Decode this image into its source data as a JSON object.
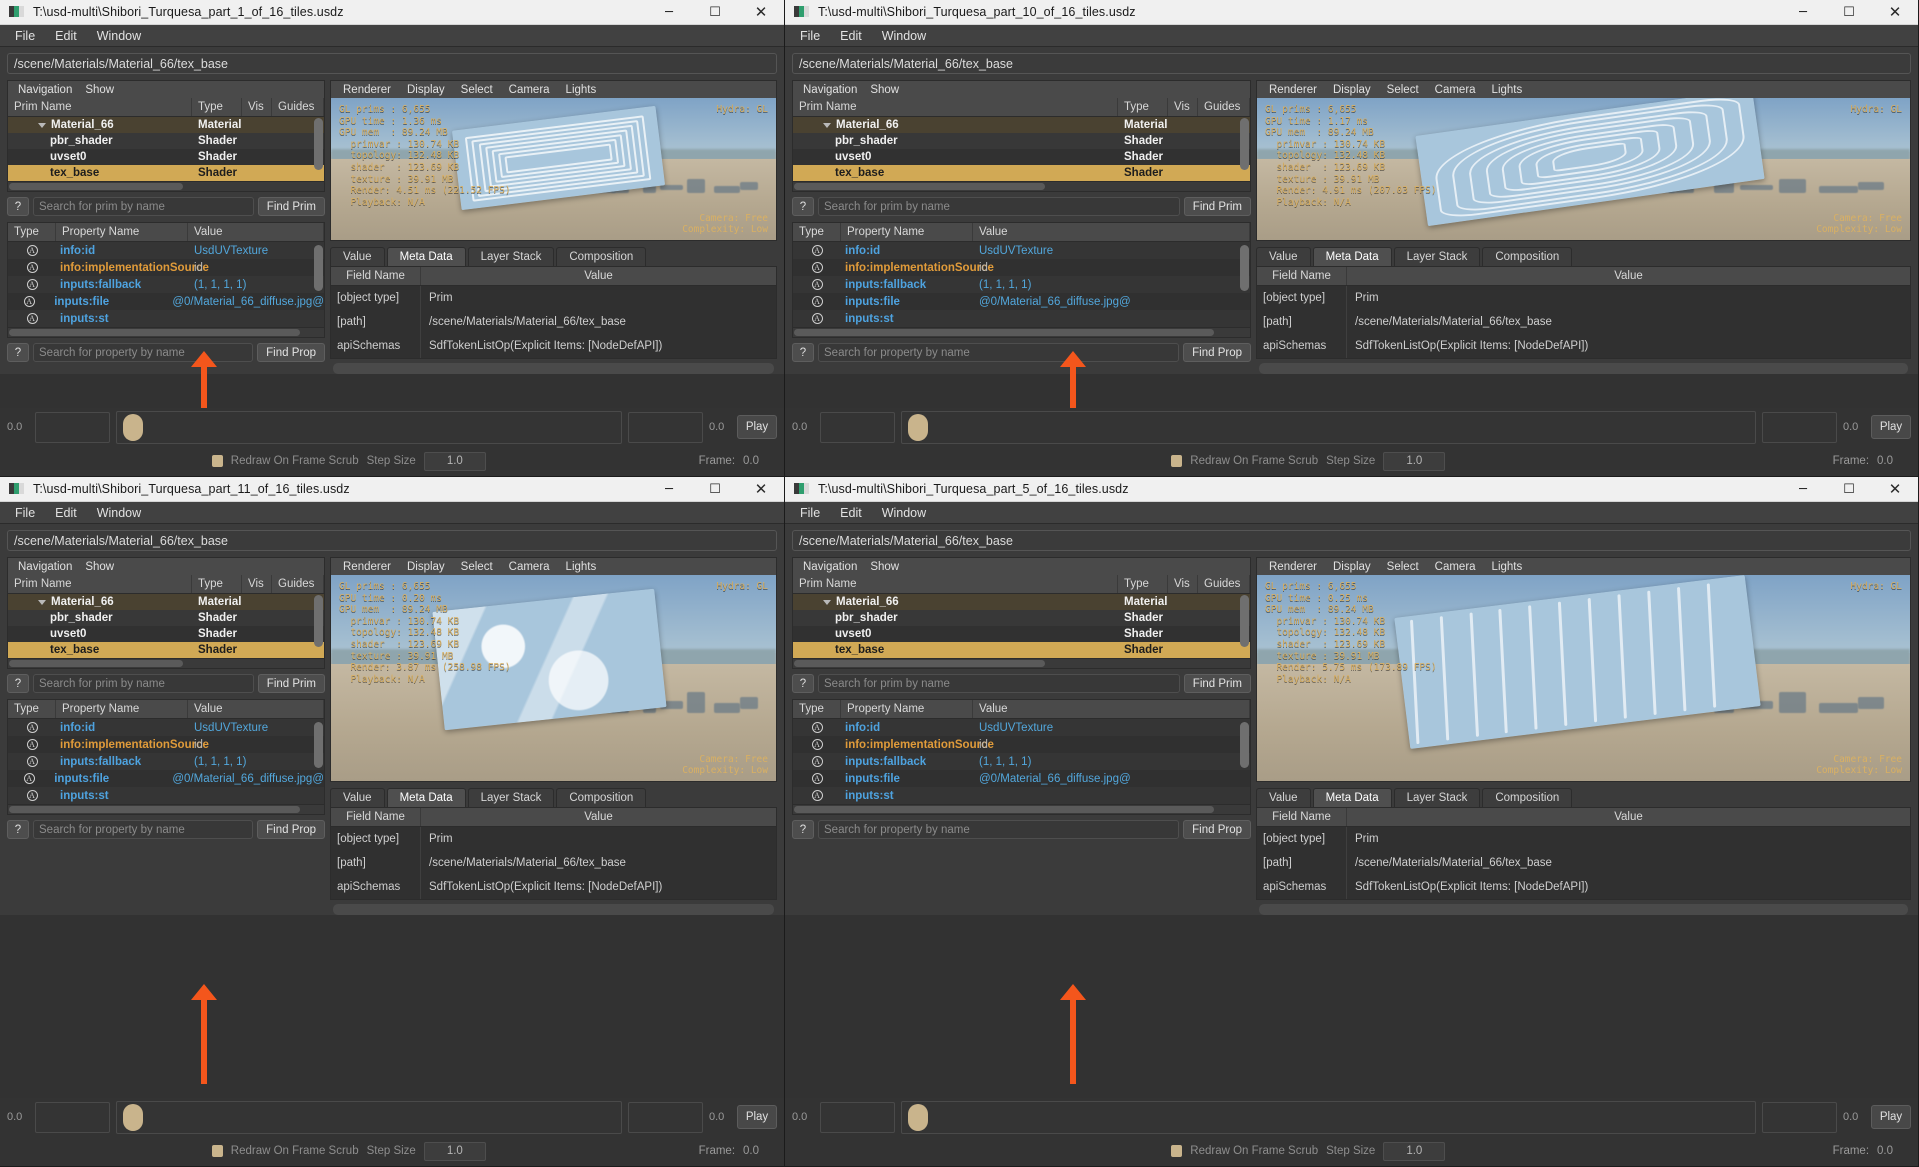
{
  "app": {
    "menubar": [
      "File",
      "Edit",
      "Window"
    ],
    "prim_path": "/scene/Materials/Material_66/tex_base",
    "nav_menu": [
      "Navigation",
      "Show"
    ],
    "viewport_menu": [
      "Renderer",
      "Display",
      "Select",
      "Camera",
      "Lights"
    ],
    "tree_headers": [
      "Prim Name",
      "Type",
      "Vis",
      "Guides"
    ],
    "tree_rows": [
      {
        "name": "Material_66",
        "type": "Material",
        "vis": "",
        "guides": ""
      },
      {
        "name": "pbr_shader",
        "type": "Shader",
        "vis": "",
        "guides": ""
      },
      {
        "name": "uvset0",
        "type": "Shader",
        "vis": "",
        "guides": ""
      },
      {
        "name": "tex_base",
        "type": "Shader",
        "vis": "",
        "guides": ""
      }
    ],
    "prim_search": {
      "placeholder": "Search for prim by name",
      "value": "",
      "help": "?",
      "button": "Find Prim"
    },
    "prop_search": {
      "placeholder": "Search for property by name",
      "value": "",
      "help": "?",
      "button": "Find Prop"
    },
    "prop_headers": [
      "Type",
      "Property Name",
      "Value"
    ],
    "prop_rows": [
      {
        "icon": "A",
        "name": "info:id",
        "value": "UsdUVTexture",
        "name_color": "blue",
        "value_color": "blue"
      },
      {
        "icon": "A",
        "name": "info:implementationSource",
        "value": "id",
        "name_color": "orange",
        "value_color": "plain"
      },
      {
        "icon": "A",
        "name": "inputs:fallback",
        "value": "(1, 1, 1, 1)",
        "name_color": "blue",
        "value_color": "blue"
      },
      {
        "icon": "A",
        "name": "inputs:file",
        "value": "@0/Material_66_diffuse.jpg@",
        "name_color": "blue",
        "value_color": "blue"
      },
      {
        "icon": "A",
        "name": "inputs:st",
        "value": "",
        "name_color": "blue",
        "value_color": "blue"
      }
    ],
    "meta_tabs": [
      "Value",
      "Meta Data",
      "Layer Stack",
      "Composition"
    ],
    "meta_active_tab": "Meta Data",
    "meta_headers": [
      "Field Name",
      "Value"
    ],
    "meta_rows": [
      {
        "field": "[object type]",
        "value": "Prim"
      },
      {
        "field": "[path]",
        "value": "/scene/Materials/Material_66/tex_base"
      },
      {
        "field": "apiSchemas",
        "value": "SdfTokenListOp(Explicit Items: [NodeDefAPI])"
      }
    ],
    "timeline": {
      "start": "0.0",
      "end": "0.0",
      "play_label": "Play",
      "redraw_label": "Redraw On Frame Scrub",
      "step_label": "Step Size",
      "step_value": "1.0",
      "frame_label": "Frame:",
      "frame_value": "0.0"
    },
    "window_buttons": {
      "minimize": "─",
      "maximize": "☐",
      "close": "✕"
    },
    "hud_right_label": "Hydra: GL",
    "hud_bottom": [
      "Camera: Free",
      "Complexity: Low"
    ],
    "colors": {
      "selection": "#d1a955",
      "arrow": "#f4561c",
      "hud_text": "#d9b063",
      "prop_blue": "#4ea3e0",
      "prop_orange": "#e09b3a"
    }
  },
  "windows": [
    {
      "id": "win-1",
      "title": "T:\\usd-multi\\Shibori_Turquesa_part_1_of_16_tiles.usdz",
      "hud": {
        "gl_prims": "GL prims : 6,655",
        "gpu_time": "GPU time : 1.36 ms",
        "gpu_mem": "GPU mem  : 89.24 MB",
        "primvar": "  primvar : 130.74 KB",
        "topology": "  topology: 132.48 KB",
        "shader": "  shader  : 123.69 KB",
        "texture": "  texture : 39.91 MB",
        "render": "  Render: 4.51 ms (221.52 FPS)",
        "playback": "  Playback: N/A"
      }
    },
    {
      "id": "win-2",
      "title": "T:\\usd-multi\\Shibori_Turquesa_part_10_of_16_tiles.usdz",
      "hud": {
        "gl_prims": "GL prims : 6,655",
        "gpu_time": "GPU time : 1.17 ms",
        "gpu_mem": "GPU mem  : 89.24 MB",
        "primvar": "  primvar : 130.74 KB",
        "topology": "  topology: 132.48 KB",
        "shader": "  shader  : 123.69 KB",
        "texture": "  texture : 39.91 MB",
        "render": "  Render: 4.91 ms (207.03 FPS)",
        "playback": "  Playback: N/A"
      }
    },
    {
      "id": "win-3",
      "title": "T:\\usd-multi\\Shibori_Turquesa_part_11_of_16_tiles.usdz",
      "hud": {
        "gl_prims": "GL prims : 6,655",
        "gpu_time": "GPU time : 0.20 ms",
        "gpu_mem": "GPU mem  : 89.24 MB",
        "primvar": "  primvar : 130.74 KB",
        "topology": "  topology: 132.48 KB",
        "shader": "  shader  : 123.69 KB",
        "texture": "  texture : 39.91 MB",
        "render": "  Render: 3.87 ms (258.98 FPS)",
        "playback": "  Playback: N/A"
      }
    },
    {
      "id": "win-4",
      "title": "T:\\usd-multi\\Shibori_Turquesa_part_5_of_16_tiles.usdz",
      "hud": {
        "gl_prims": "GL prims : 6,655",
        "gpu_time": "GPU time : 0.25 ms",
        "gpu_mem": "GPU mem  : 89.24 MB",
        "primvar": "  primvar : 130.74 KB",
        "topology": "  topology: 132.48 KB",
        "shader": "  shader  : 123.69 KB",
        "texture": "  texture : 39.91 MB",
        "render": "  Render: 5.75 ms (173.89 FPS)",
        "playback": "  Playback: N/A"
      }
    }
  ]
}
